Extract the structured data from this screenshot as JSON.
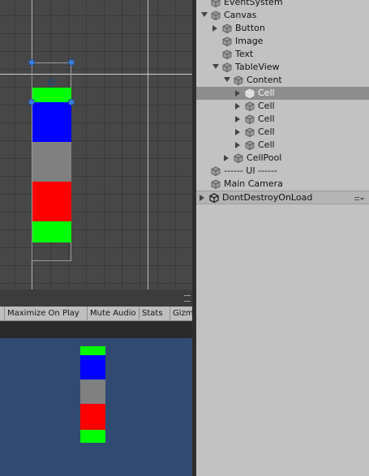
{
  "scene_view": {
    "colors": {
      "background": "#474747",
      "green": "#00ff00",
      "blue": "#0000ff",
      "gray": "#808080",
      "red": "#ff0000",
      "handle": "#3c7fd9"
    }
  },
  "game_toolbar": {
    "buttons": [
      {
        "label": "Maximize On Play"
      },
      {
        "label": "Mute Audio"
      },
      {
        "label": "Stats"
      },
      {
        "label": "Gizmos"
      }
    ]
  },
  "game_view": {
    "background": "#314a72",
    "cells": [
      "green",
      "blue",
      "gray",
      "red",
      "green"
    ]
  },
  "hierarchy": {
    "items": [
      {
        "label": "EventSystem",
        "expand": "none",
        "icon": "gameobject-cube-icon",
        "selected": false
      },
      {
        "label": "Canvas",
        "expand": "down",
        "icon": "gameobject-cube-icon",
        "selected": false
      },
      {
        "label": "Button",
        "expand": "right",
        "icon": "gameobject-cube-icon",
        "selected": false
      },
      {
        "label": "Image",
        "expand": "none",
        "icon": "gameobject-cube-icon",
        "selected": false
      },
      {
        "label": "Text",
        "expand": "none",
        "icon": "gameobject-cube-icon",
        "selected": false
      },
      {
        "label": "TableView",
        "expand": "down",
        "icon": "gameobject-cube-icon",
        "selected": false
      },
      {
        "label": "Content",
        "expand": "down",
        "icon": "gameobject-cube-icon",
        "selected": false
      },
      {
        "label": "Cell",
        "expand": "right",
        "icon": "gameobject-cube-icon",
        "selected": true
      },
      {
        "label": "Cell",
        "expand": "right",
        "icon": "gameobject-cube-icon",
        "selected": false
      },
      {
        "label": "Cell",
        "expand": "right",
        "icon": "gameobject-cube-icon",
        "selected": false
      },
      {
        "label": "Cell",
        "expand": "right",
        "icon": "gameobject-cube-icon",
        "selected": false
      },
      {
        "label": "Cell",
        "expand": "right",
        "icon": "gameobject-cube-icon",
        "selected": false
      },
      {
        "label": "CellPool",
        "expand": "right",
        "icon": "gameobject-cube-icon",
        "selected": false
      },
      {
        "label": "------ UI ------",
        "expand": "none",
        "icon": "gameobject-cube-icon",
        "selected": false
      },
      {
        "label": "Main Camera",
        "expand": "none",
        "icon": "gameobject-cube-icon",
        "selected": false
      }
    ],
    "scene_row": {
      "label": "DontDestroyOnLoad",
      "icon": "unity-logo-icon"
    }
  }
}
